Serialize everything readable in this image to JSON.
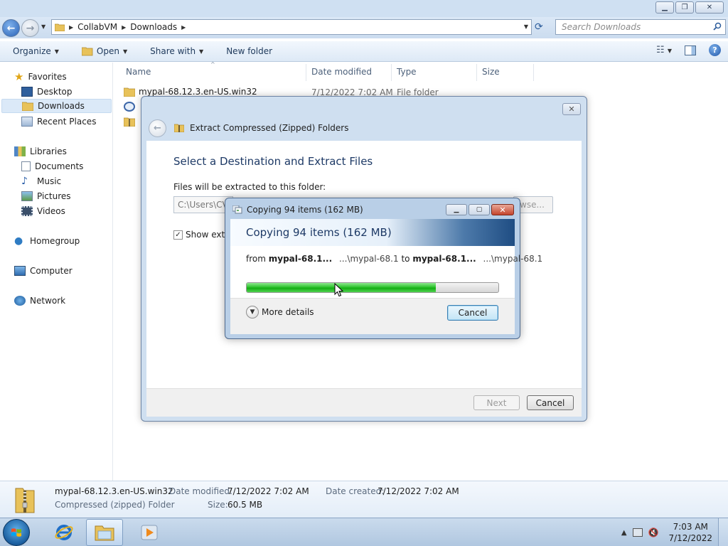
{
  "explorer": {
    "breadcrumb": [
      "CollabVM",
      "Downloads"
    ],
    "search_placeholder": "Search Downloads",
    "toolbar": {
      "organize": "Organize",
      "open": "Open",
      "share_with": "Share with",
      "new_folder": "New folder"
    },
    "nav": {
      "favorites": "Favorites",
      "desktop": "Desktop",
      "downloads": "Downloads",
      "recent_places": "Recent Places",
      "libraries": "Libraries",
      "documents": "Documents",
      "music": "Music",
      "pictures": "Pictures",
      "videos": "Videos",
      "homegroup": "Homegroup",
      "computer": "Computer",
      "network": "Network"
    },
    "columns": {
      "name": "Name",
      "date_modified": "Date modified",
      "type": "Type",
      "size": "Size"
    },
    "files": [
      {
        "name": "mypal-68.12.3.en-US.win32",
        "date": "7/12/2022 7:02 AM",
        "type": "File folder",
        "size": ""
      }
    ],
    "details": {
      "name": "mypal-68.12.3.en-US.win32",
      "kind": "Compressed (zipped) Folder",
      "date_modified_label": "Date modified:",
      "date_modified": "7/12/2022 7:02 AM",
      "date_created_label": "Date created:",
      "date_created": "7/12/2022 7:02 AM",
      "size_label": "Size:",
      "size": "60.5 MB"
    }
  },
  "wizard": {
    "title": "Extract Compressed (Zipped) Folders",
    "heading": "Select a Destination and Extract Files",
    "dest_label": "Files will be extracted to this folder:",
    "dest_path": "C:\\Users\\CV",
    "browse": "wse...",
    "show_check": "Show extra",
    "show_checked": true,
    "next": "Next",
    "cancel": "Cancel"
  },
  "copy_dialog": {
    "title": "Copying 94 items (162 MB)",
    "heading": "Copying 94 items (162 MB)",
    "from_label": "from",
    "from_name": "mypal-68.1...",
    "from_path": "...\\mypal-68.1",
    "to_label": "to",
    "to_name": "mypal-68.1...",
    "to_path": "...\\mypal-68.1",
    "progress_percent": 75,
    "more_details": "More details",
    "cancel": "Cancel"
  },
  "taskbar": {
    "time": "7:03 AM",
    "date": "7/12/2022"
  },
  "colors": {
    "progress_green": "#2fc42f",
    "accent_blue": "#1e3a66"
  }
}
